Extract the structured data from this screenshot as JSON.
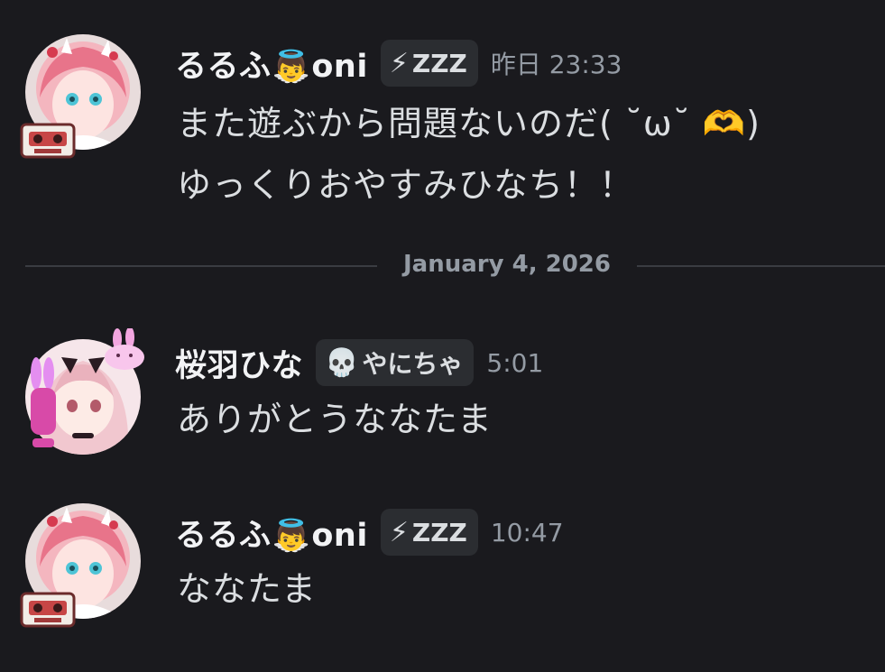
{
  "messages": [
    {
      "author": "るるふ",
      "author_emoji": "👼",
      "author_suffix": "oni",
      "tag_icon": "⚡",
      "tag": "ZZZ",
      "timestamp": "昨日 23:33",
      "lines": [
        "また遊ぶから問題ないのだ( ˘ω˘ 🫶)",
        "ゆっくりおやすみひなち！！"
      ]
    },
    {
      "author": "桜羽ひな",
      "tag_icon": "💀",
      "tag": "やにちゃ",
      "timestamp": "5:01",
      "lines": [
        "ありがとうななたま"
      ]
    },
    {
      "author": "るるふ",
      "author_emoji": "👼",
      "author_suffix": "oni",
      "tag_icon": "⚡",
      "tag": "ZZZ",
      "timestamp": "10:47",
      "lines": [
        "ななたま"
      ]
    }
  ],
  "divider": {
    "date": "January 4, 2026"
  },
  "colors": {
    "background": "#1a1a1e",
    "username": "#f2f3f5",
    "text": "#dbdee1",
    "muted": "#949ba4",
    "tag_bg": "#2b2d31",
    "divider": "#3a3c42"
  },
  "icons": {
    "avatar_1": "pink-haired-oni-avatar",
    "avatar_2": "bunny-girl-avatar",
    "avatar_3": "pink-haired-oni-avatar",
    "badge_1": "cassette-tape-icon",
    "badge_3": "cassette-tape-icon",
    "deco_2": "bunny-icon"
  }
}
